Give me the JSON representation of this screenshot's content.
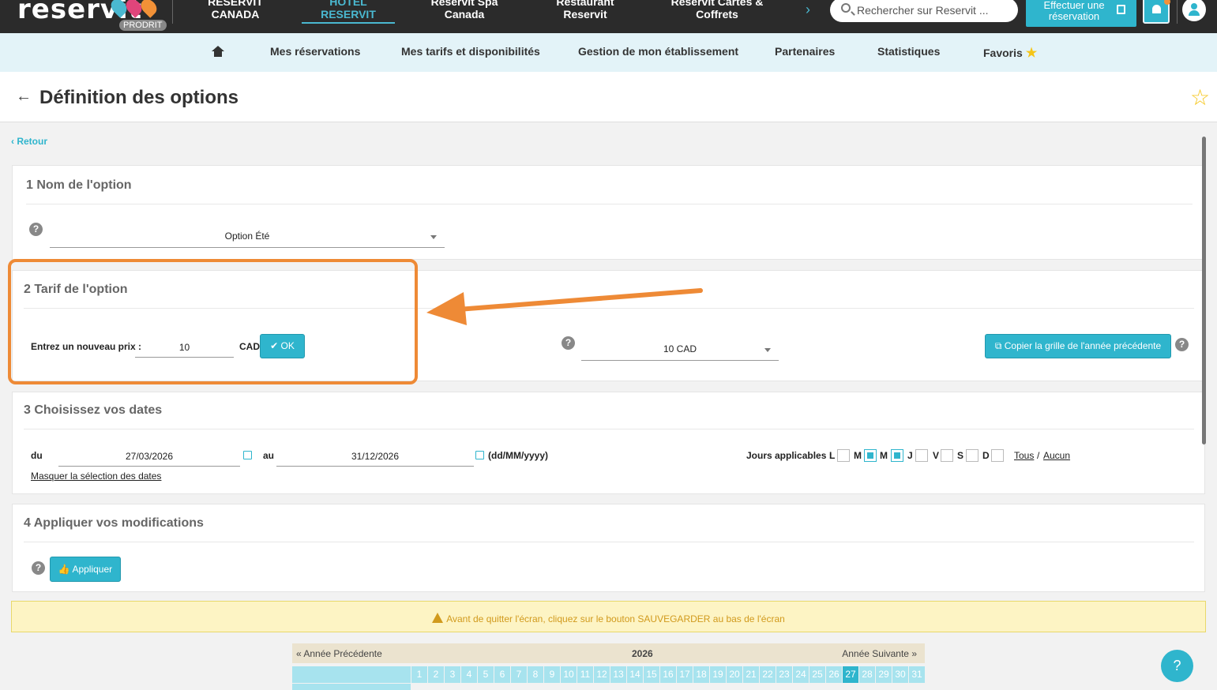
{
  "brand": {
    "logo": "reservit",
    "badge": "PRODRIT"
  },
  "topnav": {
    "items": [
      {
        "line1": "RESERVIT",
        "line2": "CANADA"
      },
      {
        "line1": "HOTEL",
        "line2": "RESERVIT"
      },
      {
        "line1": "Reservit Spa",
        "line2": "Canada"
      },
      {
        "line1": "Restaurant",
        "line2": "Reservit"
      },
      {
        "line1": "Reservit Cartes &",
        "line2": "Coffrets"
      }
    ],
    "search_placeholder": "Rechercher sur Reservit ...",
    "reserve_line1": "Effectuer une",
    "reserve_line2": "réservation"
  },
  "subnav": {
    "items": [
      "Mes réservations",
      "Mes tarifs et disponibilités",
      "Gestion de mon établissement",
      "Partenaires",
      "Statistiques",
      "Favoris"
    ]
  },
  "header": {
    "title": "Définition des options",
    "back_link": "Retour"
  },
  "section1": {
    "title": "1 Nom de l'option",
    "option_value": "Option Été"
  },
  "section2": {
    "title": "2 Tarif de l'option",
    "price_label": "Entrez un nouveau prix :",
    "price_value": "10",
    "currency": "CAD",
    "ok_label": "OK",
    "tarif_value": "10 CAD",
    "copy_label": "Copier la grille de l'année précédente"
  },
  "section3": {
    "title": "3 Choisissez vos dates",
    "from_label": "du",
    "from_value": "27/03/2026",
    "to_label": "au",
    "to_value": "31/12/2026",
    "format_hint": "(dd/MM/yyyy)",
    "hide_dates": "Masquer la sélection des dates",
    "days_label": "Jours applicables :",
    "days": [
      {
        "letter": "L",
        "checked": false
      },
      {
        "letter": "M",
        "checked": true
      },
      {
        "letter": "M",
        "checked": true
      },
      {
        "letter": "J",
        "checked": false
      },
      {
        "letter": "V",
        "checked": false
      },
      {
        "letter": "S",
        "checked": false
      },
      {
        "letter": "D",
        "checked": false
      }
    ],
    "all_label": "Tous",
    "sep": "/",
    "none_label": "Aucun"
  },
  "section4": {
    "title": "4 Appliquer vos modifications",
    "apply_label": "Appliquer"
  },
  "warning": "Avant de quitter l'écran, cliquez sur le bouton SAUVEGARDER au bas de l'écran",
  "calendar": {
    "prev": "« Année Précédente",
    "year": "2026",
    "next": "Année Suivante »",
    "days": [
      "1",
      "2",
      "3",
      "4",
      "5",
      "6",
      "7",
      "8",
      "9",
      "10",
      "11",
      "12",
      "13",
      "14",
      "15",
      "16",
      "17",
      "18",
      "19",
      "20",
      "21",
      "22",
      "23",
      "24",
      "25",
      "26",
      "27",
      "28",
      "29",
      "30",
      "31"
    ],
    "today": "27"
  },
  "help_glyph": "?",
  "colors": {
    "accent": "#2fb5cd",
    "highlight": "#ee8a36",
    "favorite": "#f5c518"
  }
}
